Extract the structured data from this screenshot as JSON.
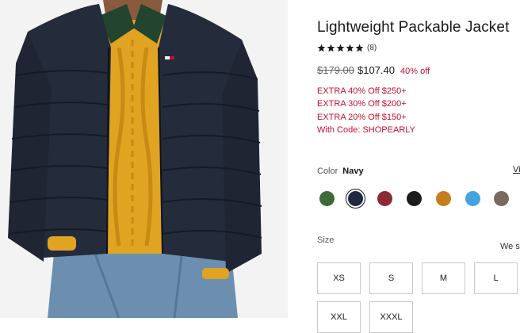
{
  "product": {
    "title": "Lightweight Packable Jacket",
    "rating": {
      "stars": 5,
      "review_count": "(8)"
    },
    "price": {
      "original": "$179.00",
      "sale": "$107.40",
      "discount": "40% off"
    },
    "promos": [
      "EXTRA 40% Off $250+",
      "EXTRA 30% Off $200+",
      "EXTRA 20% Off $150+",
      "With Code: SHOPEARLY"
    ]
  },
  "color": {
    "label": "Color",
    "selected": "Navy",
    "link": "Vi",
    "swatches": [
      {
        "name": "green",
        "hex": "#3d6b35",
        "selected": false
      },
      {
        "name": "navy",
        "hex": "#1f2940",
        "selected": true
      },
      {
        "name": "burgundy",
        "hex": "#8c2a35",
        "selected": false
      },
      {
        "name": "black",
        "hex": "#1c1c1c",
        "selected": false
      },
      {
        "name": "tan",
        "hex": "#c67c1f",
        "selected": false
      },
      {
        "name": "light-blue",
        "hex": "#44a3dd",
        "selected": false
      },
      {
        "name": "taupe",
        "hex": "#7a6a5e",
        "selected": false
      }
    ]
  },
  "size": {
    "label": "Size",
    "note": "We s",
    "options": [
      "XS",
      "S",
      "M",
      "L",
      "XXL",
      "XXXL"
    ]
  },
  "colors": {
    "accent_red": "#c8102e",
    "text": "#1a1a1a"
  }
}
